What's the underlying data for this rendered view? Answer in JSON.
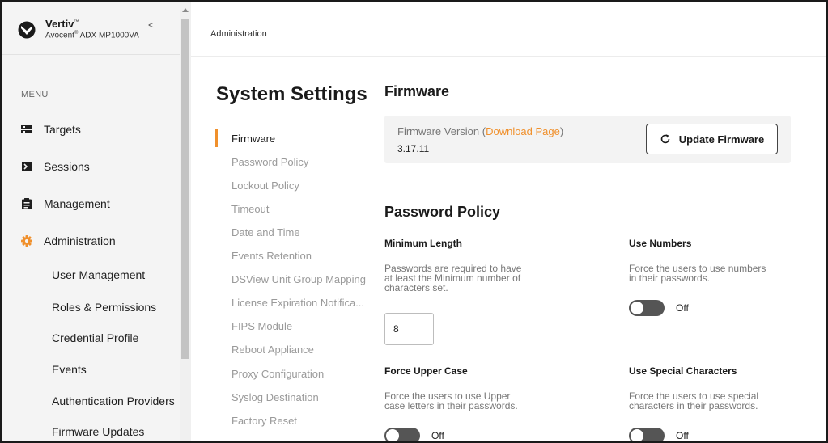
{
  "brand": {
    "name": "Vertiv",
    "name_tm": "™",
    "model_prefix": "Avocent",
    "model_reg": "®",
    "model_suffix": " ADX MP1000VA",
    "collapse_glyph": "<",
    "logo_icon": "vertiv-logo-icon"
  },
  "sidebar": {
    "menu_title": "MENU",
    "items": [
      {
        "label": "Targets",
        "icon": "targets-icon"
      },
      {
        "label": "Sessions",
        "icon": "sessions-icon"
      },
      {
        "label": "Management",
        "icon": "clipboard-icon"
      },
      {
        "label": "Administration",
        "icon": "gear-icon",
        "active": true
      }
    ],
    "sub_items": [
      "User Management",
      "Roles & Permissions",
      "Credential Profile",
      "Events",
      "Authentication Providers",
      "Firmware Updates"
    ]
  },
  "topbar": {
    "breadcrumb": "Administration"
  },
  "settings": {
    "title": "System Settings",
    "nav": [
      {
        "label": "Firmware",
        "active": true
      },
      {
        "label": "Password Policy"
      },
      {
        "label": "Lockout Policy"
      },
      {
        "label": "Timeout"
      },
      {
        "label": "Date and Time"
      },
      {
        "label": "Events Retention"
      },
      {
        "label": "DSView Unit Group Mapping"
      },
      {
        "label": "License Expiration Notifica..."
      },
      {
        "label": "FIPS Module"
      },
      {
        "label": "Reboot Appliance"
      },
      {
        "label": "Proxy Configuration"
      },
      {
        "label": "Syslog Destination"
      },
      {
        "label": "Factory Reset"
      }
    ]
  },
  "firmware": {
    "section_title": "Firmware",
    "version_label": "Firmware Version (",
    "download_link": "Download Page",
    "version_label_end": ")",
    "version_value": "3.17.11",
    "update_button": "Update Firmware"
  },
  "password_policy": {
    "section_title": "Password Policy",
    "min_length": {
      "title": "Minimum Length",
      "desc_lines": [
        "Passwords are required to have",
        "at least the Minimum number of",
        "characters set."
      ],
      "value": "8"
    },
    "use_numbers": {
      "title": "Use Numbers",
      "desc_lines": [
        "Force the users to use numbers",
        "in their passwords."
      ],
      "state": "Off"
    },
    "force_upper": {
      "title": "Force Upper Case",
      "desc_lines": [
        "Force the users to use Upper",
        "case letters in their passwords."
      ],
      "state": "Off"
    },
    "use_special": {
      "title": "Use Special Characters",
      "desc_lines": [
        "Force the users to use special",
        "characters in their passwords."
      ],
      "state": "Off"
    }
  },
  "colors": {
    "accent": "#f0902c",
    "toggle_off": "#555555"
  }
}
